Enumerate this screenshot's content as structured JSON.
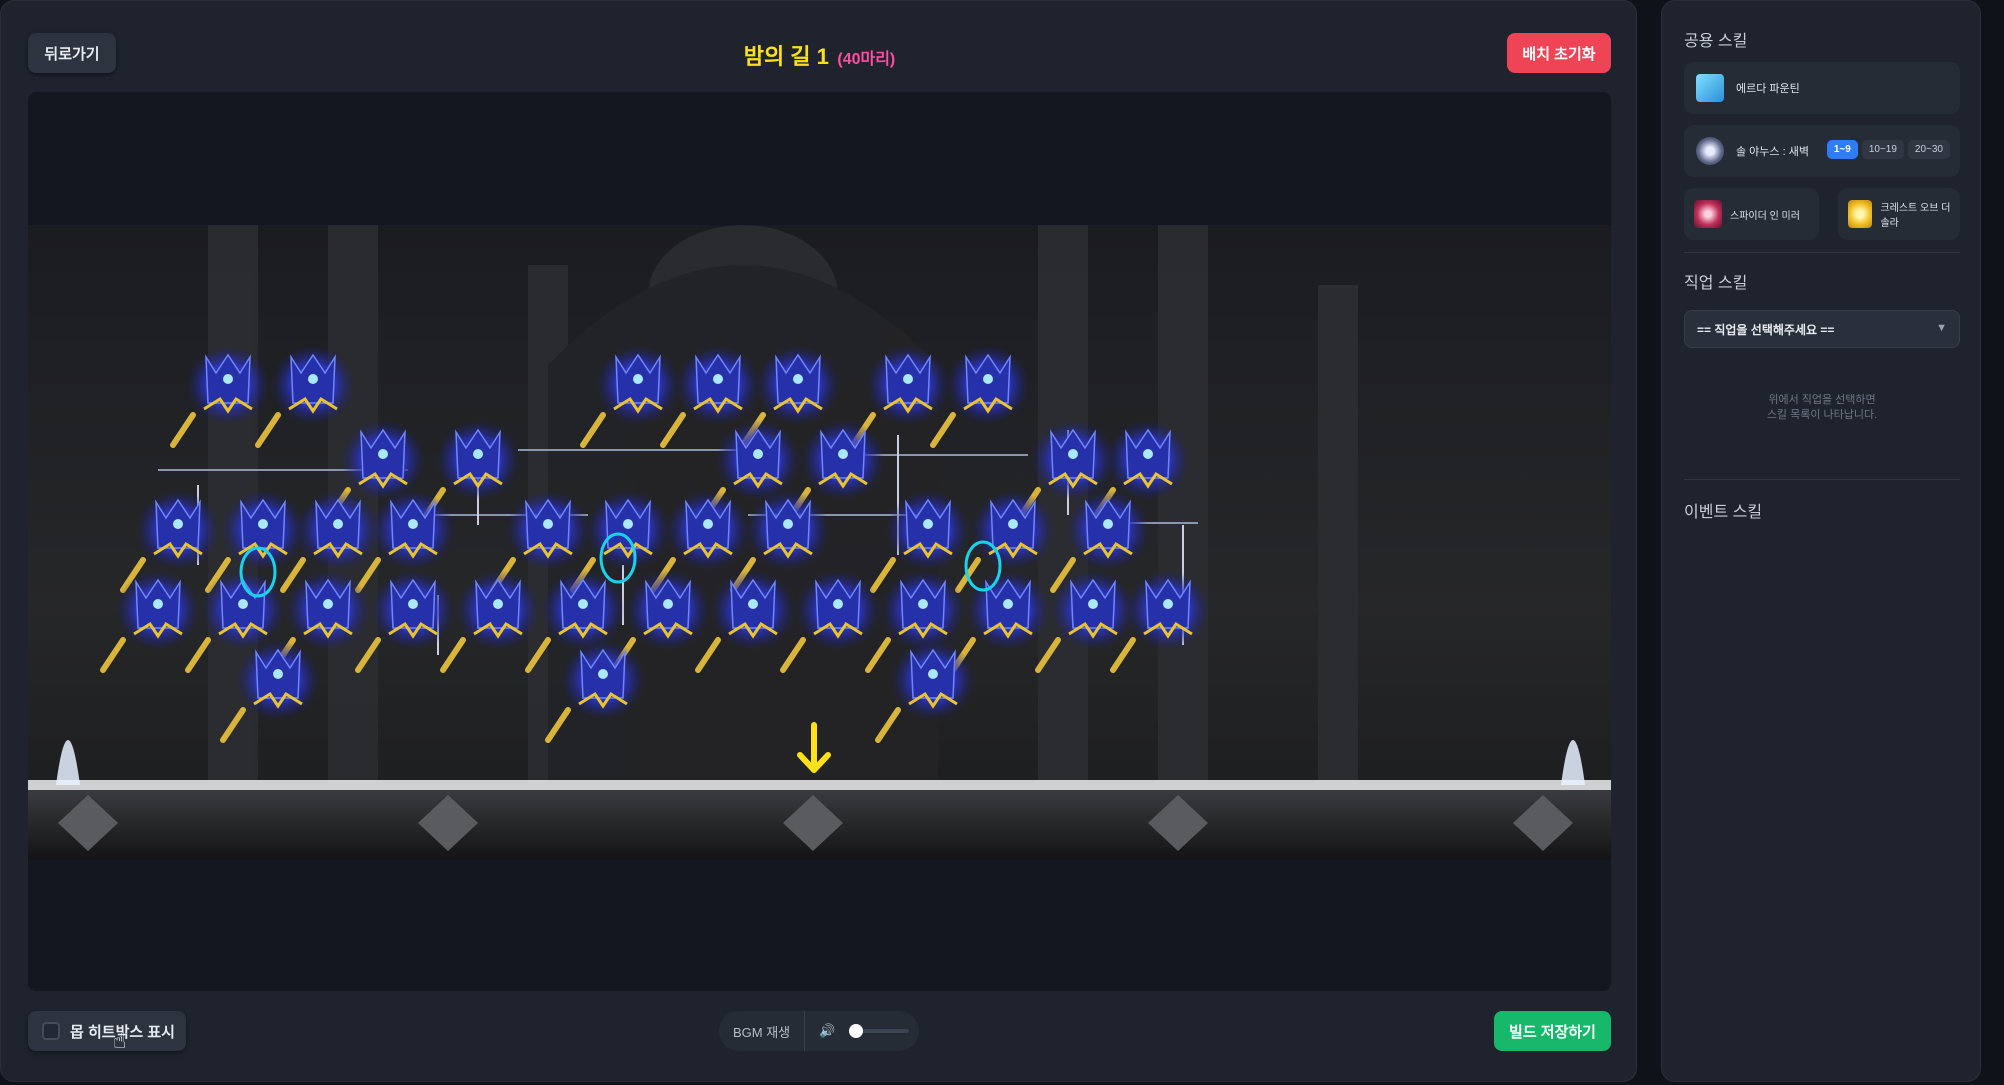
{
  "header": {
    "back_label": "뒤로가기",
    "title": "밤의 길 1",
    "subtitle": "(40마리)",
    "reset_label": "배치 초기화"
  },
  "footer": {
    "hitbox_label": "몹 히트박스 표시",
    "hitbox_checked": false,
    "bgm_label": "BGM 재생",
    "bgm_volume": 0,
    "save_label": "빌드 저장하기"
  },
  "sidebar": {
    "common_title": "공용 스킬",
    "common_skills": [
      {
        "name": "에르다 파운틴",
        "icon": "erda-fountain-icon"
      },
      {
        "name": "솔 야누스 : 새벽",
        "icon": "sol-janus-dawn-icon",
        "levels": [
          "1~9",
          "10~19",
          "20~30"
        ],
        "active_level": "1~9"
      },
      {
        "name": "스파이더 인 미러",
        "icon": "spider-in-mirror-icon"
      },
      {
        "name": "크레스트 오브 더 솔라",
        "icon": "crest-of-the-solar-icon"
      }
    ],
    "job_title": "직업 스킬",
    "job_select_placeholder": "== 직업을 선택해주세요 ==",
    "job_hint_line1": "위에서 직업을 선택하면",
    "job_hint_line2": "스킬 목록이 나타납니다.",
    "event_title": "이벤트 스킬"
  },
  "colors": {
    "title": "#ffe11a",
    "subtitle": "#ff4fa3",
    "reset": "#ef4456",
    "save": "#18b86a",
    "level_active": "#2f7df6",
    "hitbox_marker": "#19d3ee",
    "spawn_arrow": "#ffe11a"
  }
}
